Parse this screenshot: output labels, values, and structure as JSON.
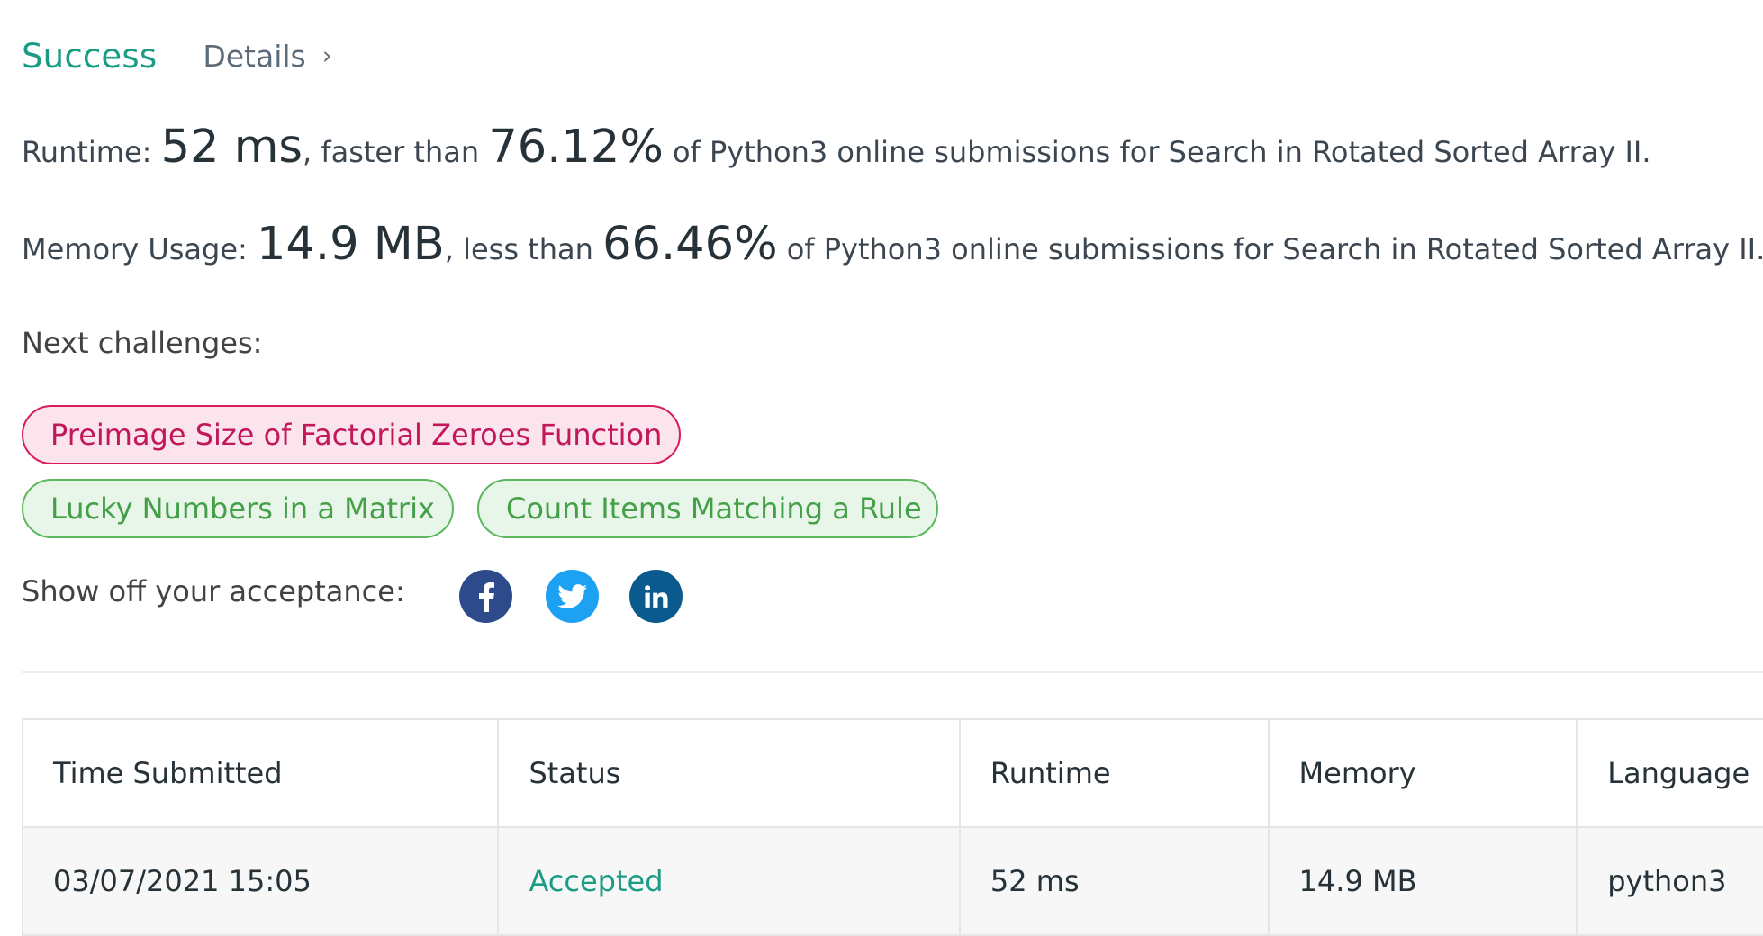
{
  "header": {
    "status": "Success",
    "details_label": "Details",
    "chevron": "›"
  },
  "runtime_stat": {
    "prefix": "Runtime: ",
    "value": "52 ms",
    "mid": ", faster than ",
    "percent": "76.12%",
    "suffix": " of Python3 online submissions for Search in Rotated Sorted Array II."
  },
  "memory_stat": {
    "prefix": "Memory Usage: ",
    "value": "14.9 MB",
    "mid": ", less than ",
    "percent": "66.46%",
    "suffix": " of Python3 online submissions for Search in Rotated Sorted Array II."
  },
  "next_challenges": {
    "label": "Next challenges:",
    "items": [
      {
        "title": "Preimage Size of Factorial Zeroes Function",
        "difficulty": "hard"
      },
      {
        "title": "Lucky Numbers in a Matrix",
        "difficulty": "easy"
      },
      {
        "title": "Count Items Matching a Rule",
        "difficulty": "easy"
      }
    ]
  },
  "share": {
    "label": "Show off your acceptance:",
    "icons": [
      "facebook-icon",
      "twitter-icon",
      "linkedin-icon"
    ]
  },
  "table": {
    "headers": [
      "Time Submitted",
      "Status",
      "Runtime",
      "Memory",
      "Language"
    ],
    "rows": [
      [
        "03/07/2021 15:05",
        "Accepted",
        "52 ms",
        "14.9 MB",
        "python3"
      ]
    ]
  },
  "colors": {
    "success": "#1a9c85",
    "hard_border": "#d81b60",
    "easy_border": "#5cb85c",
    "facebook": "#2d4a8a",
    "twitter": "#1da1f2",
    "linkedin": "#0a5a8e"
  }
}
